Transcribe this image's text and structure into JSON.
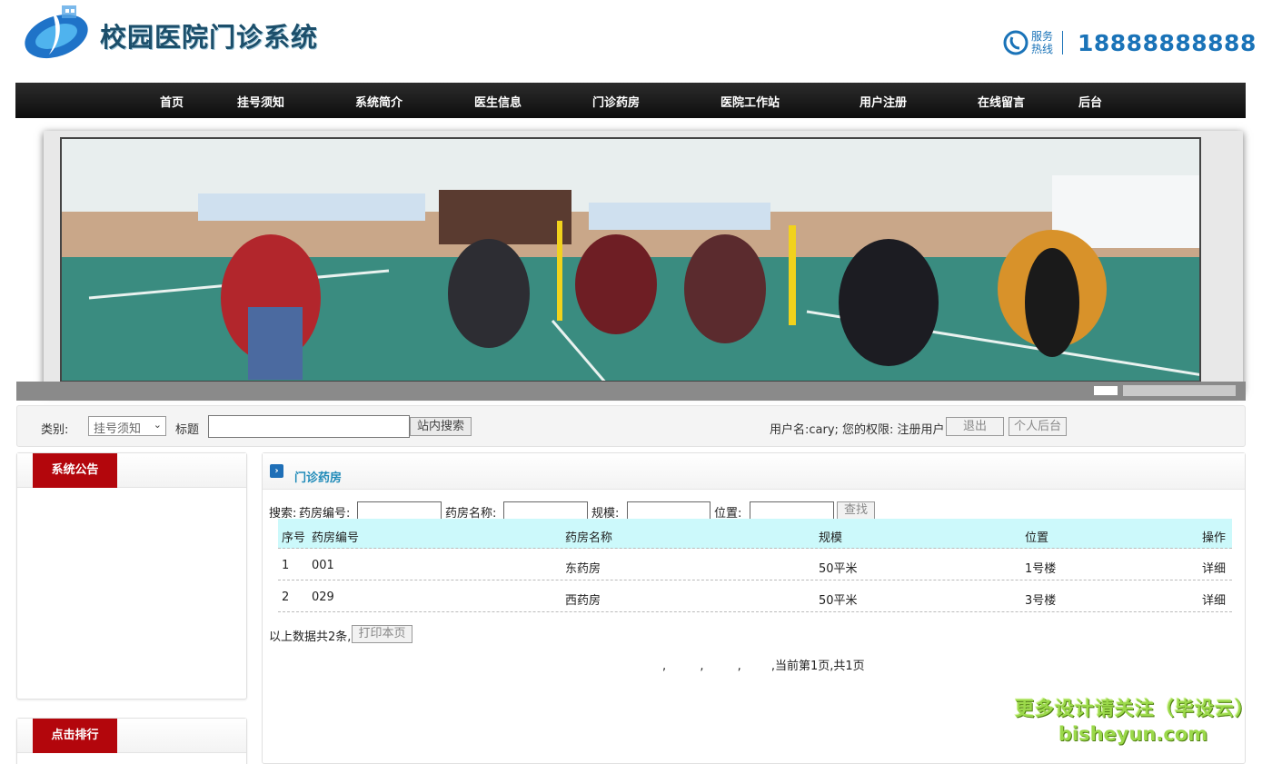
{
  "site": {
    "title": "校园医院门诊系统"
  },
  "hotline": {
    "label_line1": "服务",
    "label_line2": "热线",
    "number": "18888888888"
  },
  "nav": {
    "items": [
      {
        "label": "首页"
      },
      {
        "label": "挂号须知"
      },
      {
        "label": "系统简介"
      },
      {
        "label": "医生信息"
      },
      {
        "label": "门诊药房"
      },
      {
        "label": "医院工作站"
      },
      {
        "label": "用户注册"
      },
      {
        "label": "在线留言"
      },
      {
        "label": "后台"
      }
    ]
  },
  "searchbar": {
    "category_label": "类别:",
    "category_value": "挂号须知",
    "title_label": "标题",
    "search_button": "站内搜索",
    "user_info": "用户名:cary;  您的权限: 注册用户",
    "logout_button": "退出",
    "personal_button": "个人后台"
  },
  "sidebar": {
    "notice_title": "系统公告",
    "ranking_title": "点击排行"
  },
  "main": {
    "title": "门诊药房",
    "filters": {
      "prefix": "搜索:",
      "code_label": "药房编号:",
      "name_label": "药房名称:",
      "scale_label": "规模:",
      "location_label": "位置:",
      "find_button": "查找"
    },
    "table": {
      "headers": [
        "序号",
        "药房编号",
        "药房名称",
        "规模",
        "位置",
        "操作"
      ],
      "rows": [
        {
          "index": "1",
          "code": "001",
          "name": "东药房",
          "scale": "50平米",
          "location": "1号楼",
          "action": "详细"
        },
        {
          "index": "2",
          "code": "029",
          "name": "西药房",
          "scale": "50平米",
          "location": "3号楼",
          "action": "详细"
        }
      ]
    },
    "total_text": "以上数据共2条,",
    "print_button": "打印本页",
    "pager_text": ",         ,         ,        ,当前第1页,共1页"
  },
  "watermark": {
    "line1": "更多设计请关注（毕设云）",
    "line2": "bisheyun.com"
  },
  "colors": {
    "nav_bg": "#111111",
    "panel_tab": "#b3060c",
    "hotline": "#1a73b8",
    "table_head": "#ccf9fb",
    "title_blue": "#1f8ab8"
  }
}
